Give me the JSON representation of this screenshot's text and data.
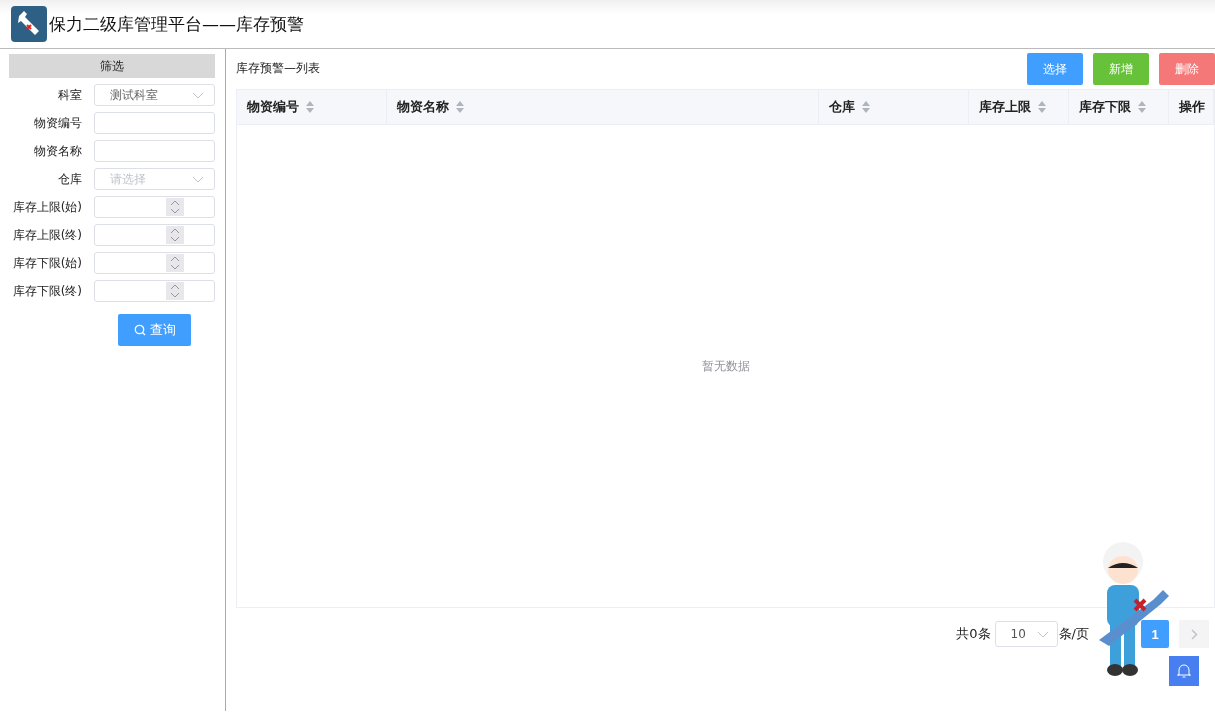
{
  "header": {
    "title": "保力二级库管理平台——库存预警"
  },
  "filter": {
    "title": "筛选",
    "fields": [
      {
        "kind": "select",
        "label": "科室",
        "value": "测试科室"
      },
      {
        "kind": "text",
        "label": "物资编号"
      },
      {
        "kind": "text",
        "label": "物资名称"
      },
      {
        "kind": "select",
        "label": "仓库",
        "placeholder": "请选择"
      },
      {
        "kind": "number",
        "label": "库存上限(始)"
      },
      {
        "kind": "number",
        "label": "库存上限(终)"
      },
      {
        "kind": "number",
        "label": "库存下限(始)"
      },
      {
        "kind": "number",
        "label": "库存下限(终)"
      }
    ],
    "search_button": "查询"
  },
  "list": {
    "title": "库存预警—列表",
    "buttons": [
      {
        "label": "选择",
        "kind": "primary"
      },
      {
        "label": "新增",
        "kind": "success"
      },
      {
        "label": "删除",
        "kind": "danger"
      }
    ],
    "table": {
      "columns": [
        {
          "label": "物资编号",
          "sortable": true
        },
        {
          "label": "物资名称",
          "sortable": true
        },
        {
          "label": "仓库",
          "sortable": true
        },
        {
          "label": "库存上限",
          "sortable": true
        },
        {
          "label": "库存下限",
          "sortable": true
        },
        {
          "label": "操作",
          "sortable": false
        }
      ],
      "empty_text": "暂无数据"
    },
    "pagination": {
      "total": "共0条",
      "page_size": "10",
      "page_size_suffix": "条/页",
      "pages": [
        {
          "label": "1",
          "selected": true
        }
      ]
    }
  }
}
